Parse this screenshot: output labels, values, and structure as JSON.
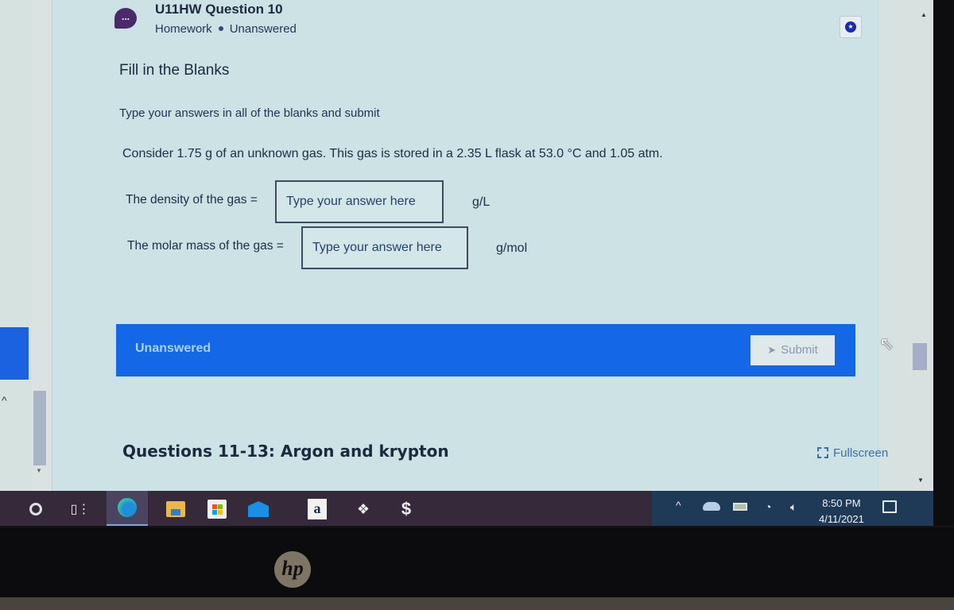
{
  "header": {
    "title": "U11HW Question 10",
    "category": "Homework",
    "status": "Unanswered",
    "chat_icon_glyph": "...",
    "bookmark_icon": "star-icon"
  },
  "question": {
    "type_heading": "Fill in the Blanks",
    "instructions": "Type your answers in all of the blanks and submit",
    "prompt": "Consider 1.75 g of an unknown gas. This gas is stored in a 2.35 L flask at 53.0 °C and 1.05 atm.",
    "blanks": [
      {
        "label": "The density of the gas =",
        "placeholder": "Type your answer here",
        "value": "",
        "unit": "g/L"
      },
      {
        "label": "The molar mass of the gas =",
        "placeholder": "Type your answer here",
        "value": "",
        "unit": "g/mol"
      }
    ]
  },
  "status_bar": {
    "status": "Unanswered",
    "submit_label": "Submit",
    "submit_icon": "paper-plane-icon",
    "accent_color": "#1467e6"
  },
  "next_section": {
    "title": "Questions 11-13: Argon and krypton"
  },
  "fullscreen": {
    "label": "Fullscreen"
  },
  "taskbar": {
    "apps": [
      "Search",
      "Task View",
      "Microsoft Edge",
      "File Explorer",
      "Microsoft Store",
      "Mail",
      "Amazon",
      "Dropbox",
      "Klarna"
    ],
    "amazon_glyph": "a",
    "tray_caret": "^",
    "time": "8:50 PM",
    "date": "4/11/2021"
  },
  "device": {
    "brand": "hp"
  }
}
